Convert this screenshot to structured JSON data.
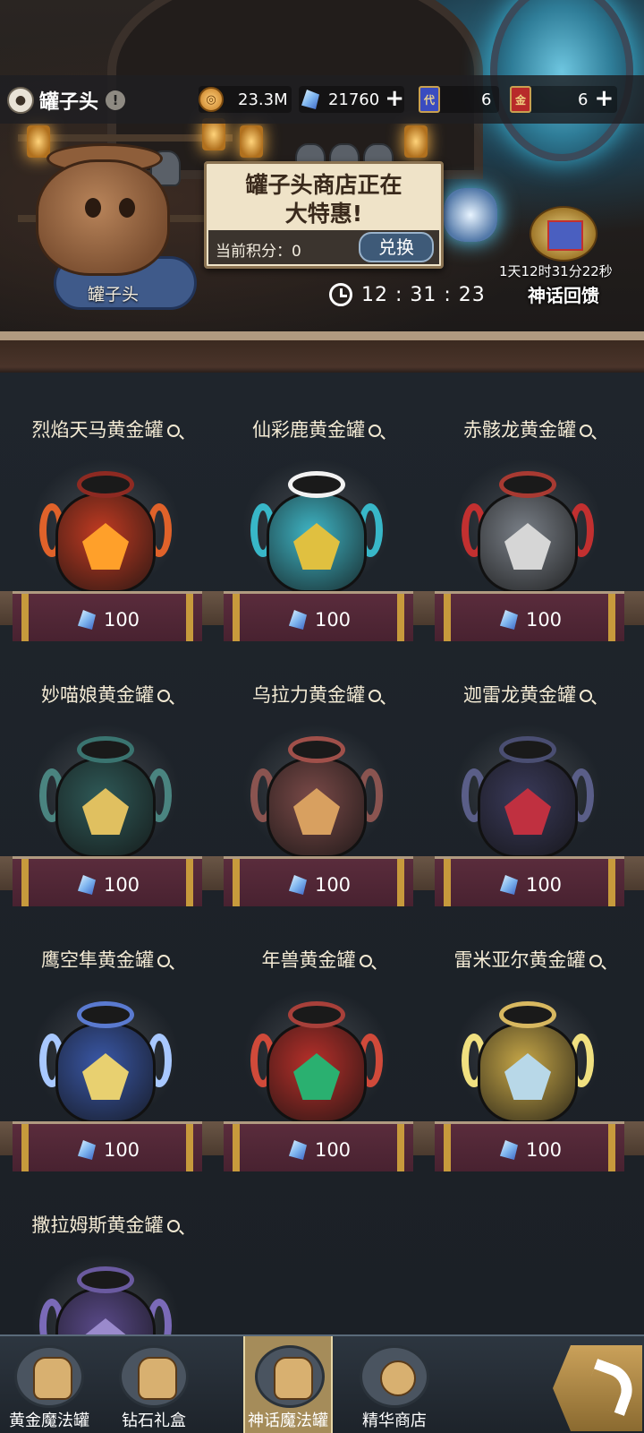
{
  "header": {
    "shop_name": "罐子头",
    "currencies": [
      {
        "icon": "coin-icon",
        "value": "23.3M"
      },
      {
        "icon": "crystal-icon",
        "value": "21760"
      },
      {
        "icon": "ticket-icon",
        "value": "6",
        "badge": "代"
      },
      {
        "icon": "gold-ticket-icon",
        "value": "6",
        "badge": "金"
      }
    ]
  },
  "scene": {
    "character_name": "罐子头"
  },
  "banner": {
    "title": "罐子头商店正在\n大特惠!",
    "points_label": "当前积分：0",
    "exchange_label": "兑换"
  },
  "timer": "12 : 31 : 23",
  "myth_gift": {
    "countdown": "1天12时31分22秒",
    "label": "神话回馈"
  },
  "jars": [
    {
      "name": "烈焰天马黄金罐",
      "price": "100",
      "body": "#c23b22",
      "neck": "#8e2a22",
      "emblem": "#ffa02a",
      "handle": "#e0622a"
    },
    {
      "name": "仙彩鹿黄金罐",
      "price": "100",
      "body": "#3fb6c6",
      "neck": "#f2f2f2",
      "emblem": "#e0c040",
      "handle": "#38b7c8"
    },
    {
      "name": "赤骸龙黄金罐",
      "price": "100",
      "body": "#7a8088",
      "neck": "#a83a32",
      "emblem": "#d6d6d6",
      "handle": "#c23030"
    },
    {
      "name": "妙喵娘黄金罐",
      "price": "100",
      "body": "#2f5a58",
      "neck": "#3a7470",
      "emblem": "#e0c060",
      "handle": "#4a8480"
    },
    {
      "name": "乌拉力黄金罐",
      "price": "100",
      "body": "#7a4a48",
      "neck": "#a0504a",
      "emblem": "#d8a060",
      "handle": "#8a5450"
    },
    {
      "name": "迦雷龙黄金罐",
      "price": "100",
      "body": "#3a3a5a",
      "neck": "#4a4e72",
      "emblem": "#c03040",
      "handle": "#5a5e88"
    },
    {
      "name": "鹰空隼黄金罐",
      "price": "100",
      "body": "#3a58a8",
      "neck": "#5a7ad0",
      "emblem": "#e8d070",
      "handle": "#a8c8ff"
    },
    {
      "name": "年兽黄金罐",
      "price": "100",
      "body": "#b8302a",
      "neck": "#a8403a",
      "emblem": "#2ab070",
      "handle": "#d04a3a"
    },
    {
      "name": "雷米亚尔黄金罐",
      "price": "100",
      "body": "#c8a848",
      "neck": "#d8b860",
      "emblem": "#b8d8e8",
      "handle": "#f0e080"
    },
    {
      "name": "撒拉姆斯黄金罐",
      "price": "",
      "body": "#5a4a8a",
      "neck": "#6a5aa0",
      "emblem": "#9a8acc",
      "handle": "#7a6ab8"
    }
  ],
  "nav": {
    "tabs": [
      {
        "label": "黄金魔法罐",
        "icon": "golden-jar-icon"
      },
      {
        "label": "钻石礼盒",
        "icon": "gift-box-icon"
      },
      {
        "label": "神话魔法罐",
        "icon": "myth-jar-icon"
      },
      {
        "label": "精华商店",
        "icon": "paw-icon"
      }
    ],
    "active_index": 2
  }
}
